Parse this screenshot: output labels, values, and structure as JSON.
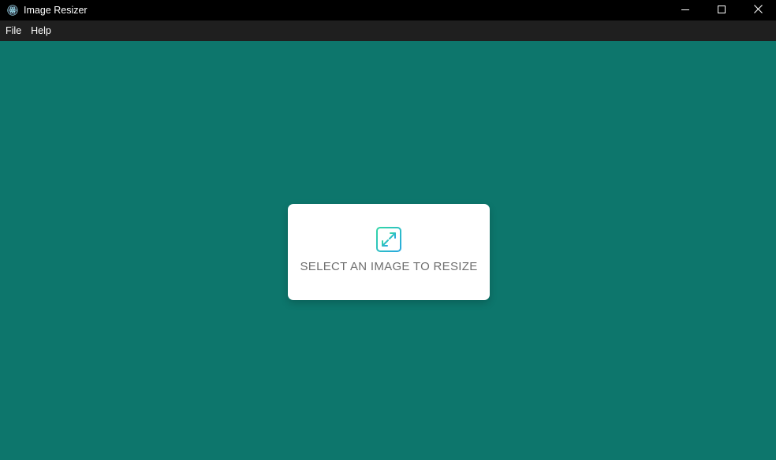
{
  "window": {
    "title": "Image Resizer",
    "icon": "electron-atom-icon"
  },
  "window_controls": {
    "minimize_icon": "minimize-icon",
    "maximize_icon": "maximize-icon",
    "close_icon": "close-icon"
  },
  "menu": {
    "items": [
      "File",
      "Help"
    ]
  },
  "main": {
    "background_color": "#0d766c",
    "select_card": {
      "icon": "expand-arrows-icon",
      "label": "SELECT AN IMAGE TO RESIZE",
      "icon_gradient": [
        "#33d6a6",
        "#29a9e0"
      ]
    }
  }
}
